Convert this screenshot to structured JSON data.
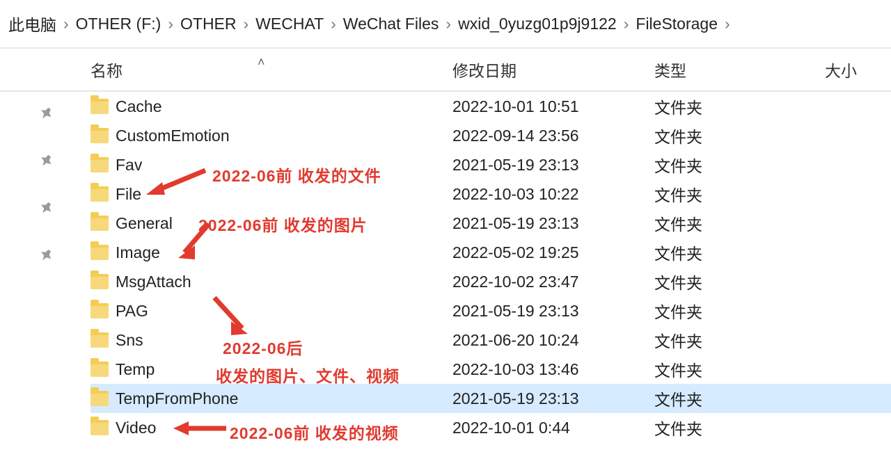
{
  "breadcrumb": [
    "此电脑",
    "OTHER (F:)",
    "OTHER",
    "WECHAT",
    "WeChat Files",
    "wxid_0yuzg01p9j9122",
    "FileStorage"
  ],
  "chevron": "›",
  "columns": {
    "name": "名称",
    "date": "修改日期",
    "type": "类型",
    "size": "大小"
  },
  "rows": [
    {
      "name": "Cache",
      "date": "2022-10-01 10:51",
      "type": "文件夹",
      "sel": false
    },
    {
      "name": "CustomEmotion",
      "date": "2022-09-14 23:56",
      "type": "文件夹",
      "sel": false
    },
    {
      "name": "Fav",
      "date": "2021-05-19 23:13",
      "type": "文件夹",
      "sel": false
    },
    {
      "name": "File",
      "date": "2022-10-03 10:22",
      "type": "文件夹",
      "sel": false
    },
    {
      "name": "General",
      "date": "2021-05-19 23:13",
      "type": "文件夹",
      "sel": false
    },
    {
      "name": "Image",
      "date": "2022-05-02 19:25",
      "type": "文件夹",
      "sel": false
    },
    {
      "name": "MsgAttach",
      "date": "2022-10-02 23:47",
      "type": "文件夹",
      "sel": false
    },
    {
      "name": "PAG",
      "date": "2021-05-19 23:13",
      "type": "文件夹",
      "sel": false
    },
    {
      "name": "Sns",
      "date": "2021-06-20 10:24",
      "type": "文件夹",
      "sel": false
    },
    {
      "name": "Temp",
      "date": "2022-10-03 13:46",
      "type": "文件夹",
      "sel": false
    },
    {
      "name": "TempFromPhone",
      "date": "2021-05-19 23:13",
      "type": "文件夹",
      "sel": true
    },
    {
      "name": "Video",
      "date": "2022-10-01 0:44",
      "type": "文件夹",
      "sel": false
    }
  ],
  "pins": 4,
  "annotations": {
    "a1": "2022-06前 收发的文件",
    "a2": "2022-06前 收发的图片",
    "a3_line1": "2022-06后",
    "a3_line2": "收发的图片、文件、视频",
    "a4": "2022-06前 收发的视频"
  }
}
